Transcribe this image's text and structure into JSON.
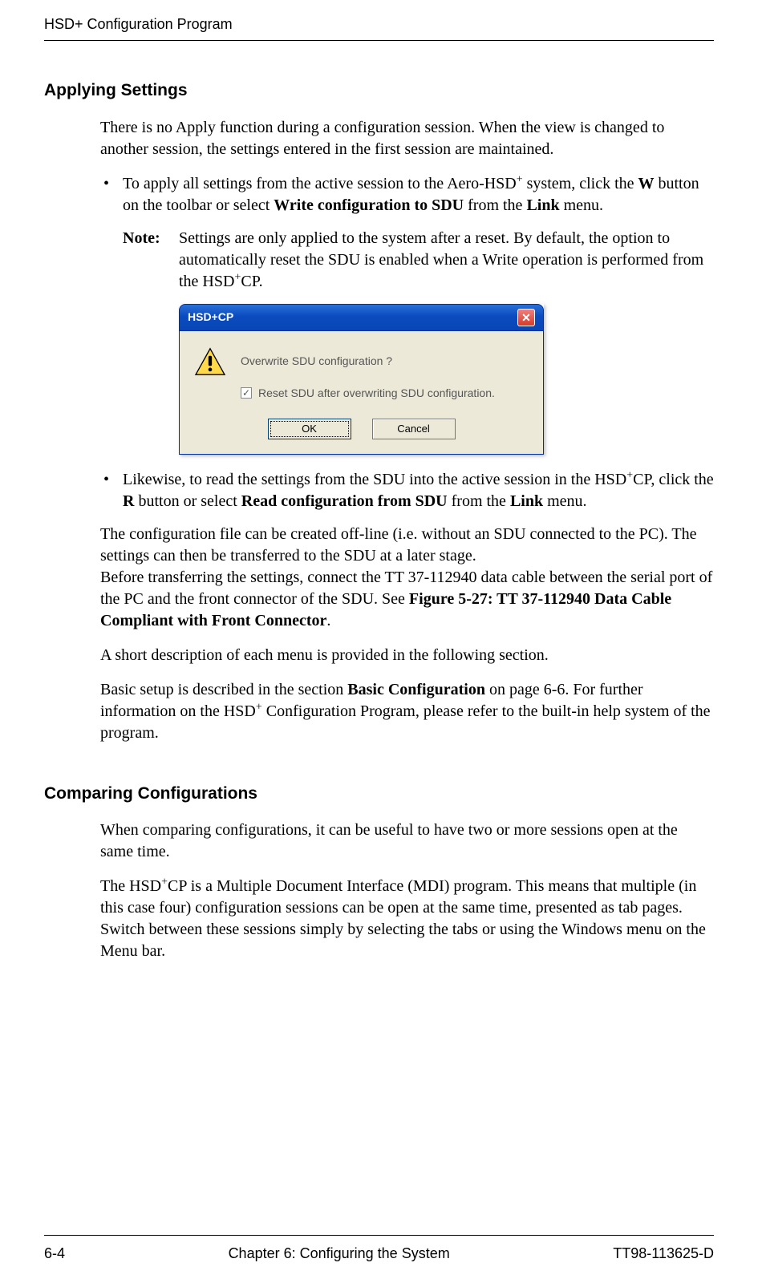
{
  "header": {
    "title": "HSD+ Configuration Program"
  },
  "section1": {
    "heading": "Applying Settings",
    "p1": "There is no Apply function during a configuration session. When the view is changed to another session, the settings entered in the first session are maintained.",
    "bullet1_a": "To apply all settings from the active session to the Aero-HSD",
    "bullet1_b": " system, click the ",
    "bullet1_c": "W",
    "bullet1_d": " button on the toolbar or select ",
    "bullet1_e": "Write configuration to SDU",
    "bullet1_f": " from the ",
    "bullet1_g": "Link",
    "bullet1_h": " menu.",
    "note_label": "Note:",
    "note_a": "Settings are only applied to the system after a reset. By default, the option to automatically reset the SDU is enabled when a Write operation is performed from the HSD",
    "note_b": "CP.",
    "bullet2_a": "Likewise, to read the settings from the SDU into the active session in the HSD",
    "bullet2_b": "CP, click the ",
    "bullet2_c": "R",
    "bullet2_d": " button or select ",
    "bullet2_e": "Read configuration from SDU",
    "bullet2_f": " from the ",
    "bullet2_g": "Link",
    "bullet2_h": " menu.",
    "p2_a": "The configuration file can be created off-line (i.e. without an SDU connected to the PC). The settings can then be transferred to the SDU at a later stage.",
    "p2_b": "Before transferring the settings, connect the TT 37-112940 data cable between the serial port of the PC and the front connector of the SDU. See ",
    "p2_c": "Figure 5-27: TT 37-112940 Data Cable Compliant with Front Connector",
    "p2_d": ".",
    "p3": "A short description of each menu is provided in the following section.",
    "p4_a": "Basic setup is described in the section ",
    "p4_b": "Basic Configuration",
    "p4_c": " on page 6-6. For further information on the HSD",
    "p4_d": " Configuration Program, please refer to the built-in help system of the program."
  },
  "dialog": {
    "title": "HSD+CP",
    "message": "Overwrite SDU configuration ?",
    "checkbox_label": "Reset SDU after overwriting SDU configuration.",
    "ok": "OK",
    "cancel": "Cancel",
    "close_glyph": "✕",
    "check_glyph": "✓"
  },
  "section2": {
    "heading": "Comparing Configurations",
    "p1": "When comparing configurations, it can be useful to have two or more sessions open at the same time.",
    "p2_a": "The HSD",
    "p2_b": "CP is a Multiple Document Interface (MDI) program. This means that multiple (in this case four) configuration sessions can be open at the same time, presented as tab pages. Switch between these sessions simply by selecting the tabs or using the Windows menu on the Menu bar."
  },
  "footer": {
    "left": "6-4",
    "center": "Chapter 6:  Configuring the System",
    "right": "TT98-113625-D"
  },
  "sup_plus": "+"
}
